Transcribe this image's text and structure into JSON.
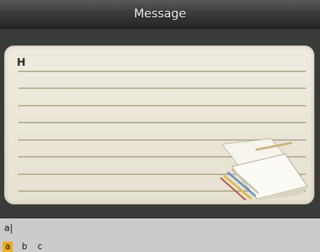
{
  "header": {
    "title": "Message"
  },
  "editor": {
    "text": "H"
  },
  "input": {
    "composing": "a|",
    "candidates": [
      "a",
      "b",
      "c"
    ],
    "selected_index": 0,
    "highlight_color": "#f1a91a"
  },
  "icons": {
    "decoration": "paper-and-pencils-icon"
  }
}
